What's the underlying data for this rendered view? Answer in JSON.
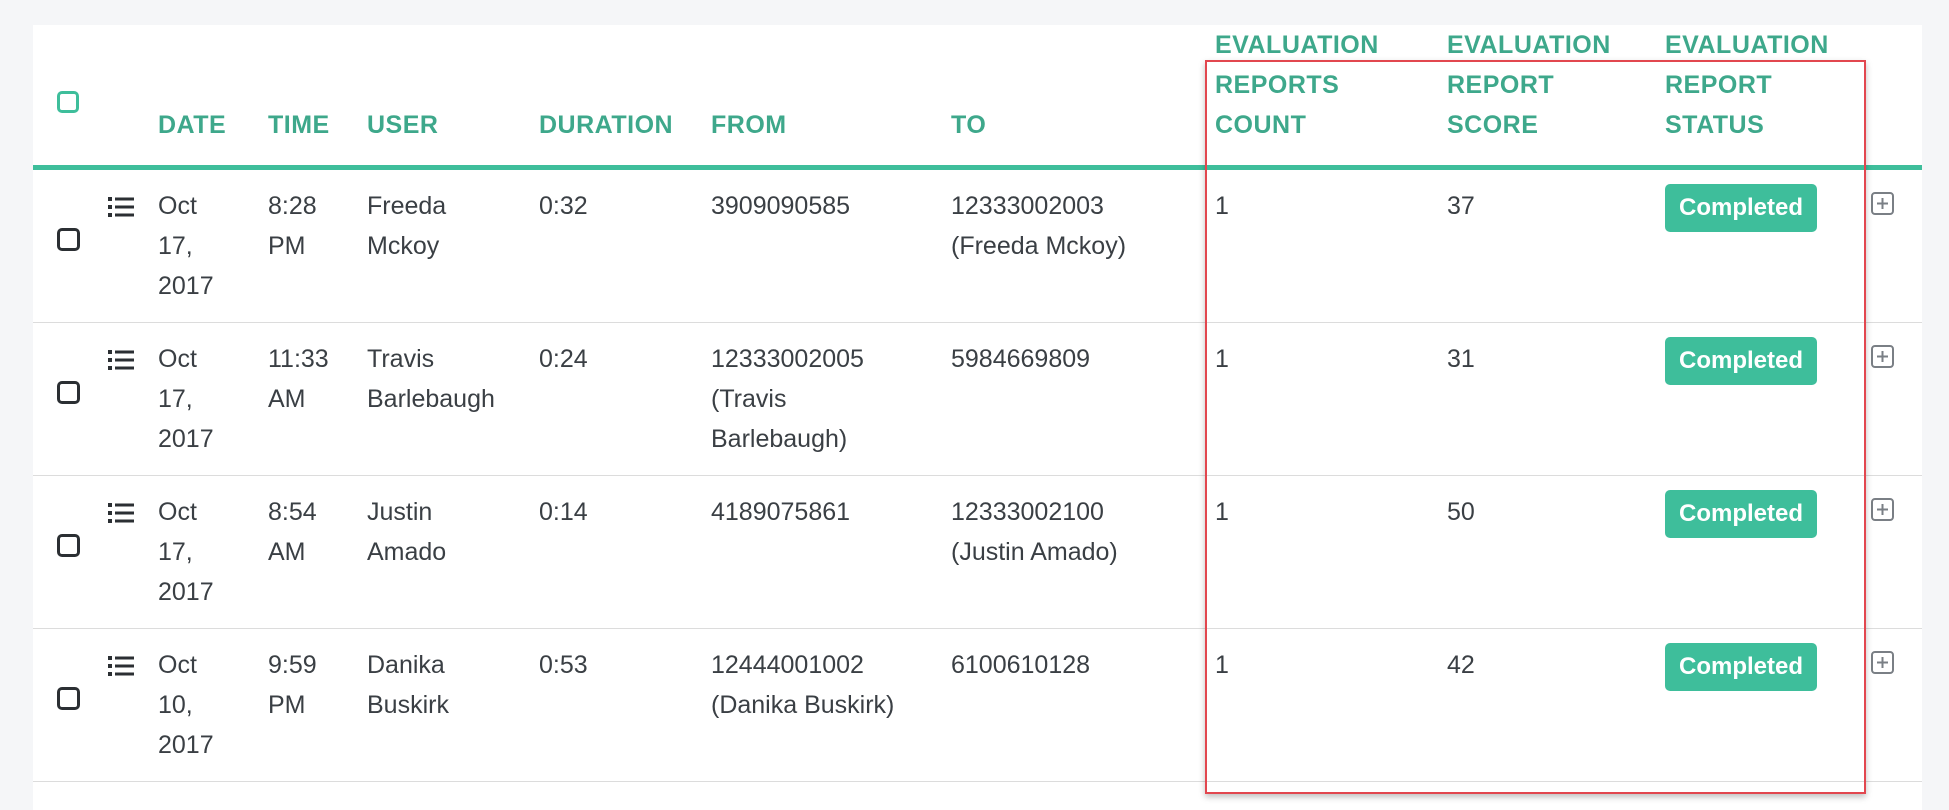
{
  "table": {
    "columns": {
      "date": "DATE",
      "time": "TIME",
      "user": "USER",
      "duration": "DURATION",
      "from": "FROM",
      "to": "TO",
      "count": [
        "EVALUATION",
        "REPORTS",
        "COUNT"
      ],
      "score": [
        "EVALUATION",
        "REPORT",
        "SCORE"
      ],
      "status": [
        "EVALUATION",
        "REPORT",
        "STATUS"
      ]
    },
    "rows": [
      {
        "date": [
          "Oct",
          "17,",
          "2017"
        ],
        "time": [
          "8:28",
          "PM"
        ],
        "user": [
          "Freeda",
          "Mckoy"
        ],
        "duration": "0:32",
        "from": [
          "3909090585"
        ],
        "to": [
          "12333002003",
          "(Freeda Mckoy)"
        ],
        "count": "1",
        "score": "37",
        "status": "Completed"
      },
      {
        "date": [
          "Oct",
          "17,",
          "2017"
        ],
        "time": [
          "11:33",
          "AM"
        ],
        "user": [
          "Travis",
          "Barlebaugh"
        ],
        "duration": "0:24",
        "from": [
          "12333002005",
          "(Travis",
          "Barlebaugh)"
        ],
        "to": [
          "5984669809"
        ],
        "count": "1",
        "score": "31",
        "status": "Completed"
      },
      {
        "date": [
          "Oct",
          "17,",
          "2017"
        ],
        "time": [
          "8:54",
          "AM"
        ],
        "user": [
          "Justin",
          "Amado"
        ],
        "duration": "0:14",
        "from": [
          "4189075861"
        ],
        "to": [
          "12333002100",
          "(Justin Amado)"
        ],
        "count": "1",
        "score": "50",
        "status": "Completed"
      },
      {
        "date": [
          "Oct",
          "10,",
          "2017"
        ],
        "time": [
          "9:59",
          "PM"
        ],
        "user": [
          "Danika",
          "Buskirk"
        ],
        "duration": "0:53",
        "from": [
          "12444001002",
          "(Danika Buskirk)"
        ],
        "to": [
          "6100610128"
        ],
        "count": "1",
        "score": "42",
        "status": "Completed"
      }
    ]
  },
  "icons": {
    "row_menu": "list-icon",
    "expand": "plus-square-icon",
    "select": "checkbox-icon"
  },
  "colors": {
    "accent": "#3ebe9b",
    "header_text": "#3ea88b",
    "highlight": "#e2474f"
  }
}
